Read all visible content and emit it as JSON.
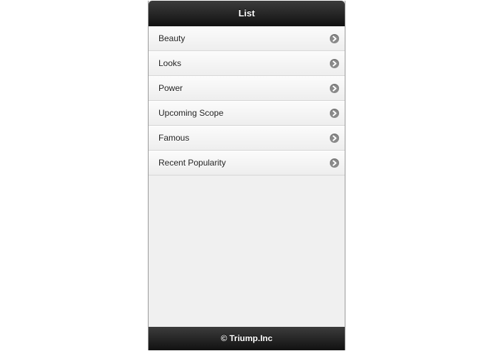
{
  "header": {
    "title": "List"
  },
  "list": {
    "items": [
      {
        "label": "Beauty",
        "icon": "arrow-right-icon"
      },
      {
        "label": "Looks",
        "icon": "arrow-right-icon"
      },
      {
        "label": "Power",
        "icon": "arrow-right-icon"
      },
      {
        "label": "Upcoming Scope",
        "icon": "arrow-right-icon"
      },
      {
        "label": "Famous",
        "icon": "arrow-right-icon"
      },
      {
        "label": "Recent Popularity",
        "icon": "arrow-right-icon"
      }
    ]
  },
  "footer": {
    "text": "© Triump.Inc"
  },
  "colors": {
    "bar_dark": "#111111",
    "bar_light": "#3c3c3c",
    "content_bg": "#f0f0f0",
    "icon_gray": "#8a8a8a"
  }
}
